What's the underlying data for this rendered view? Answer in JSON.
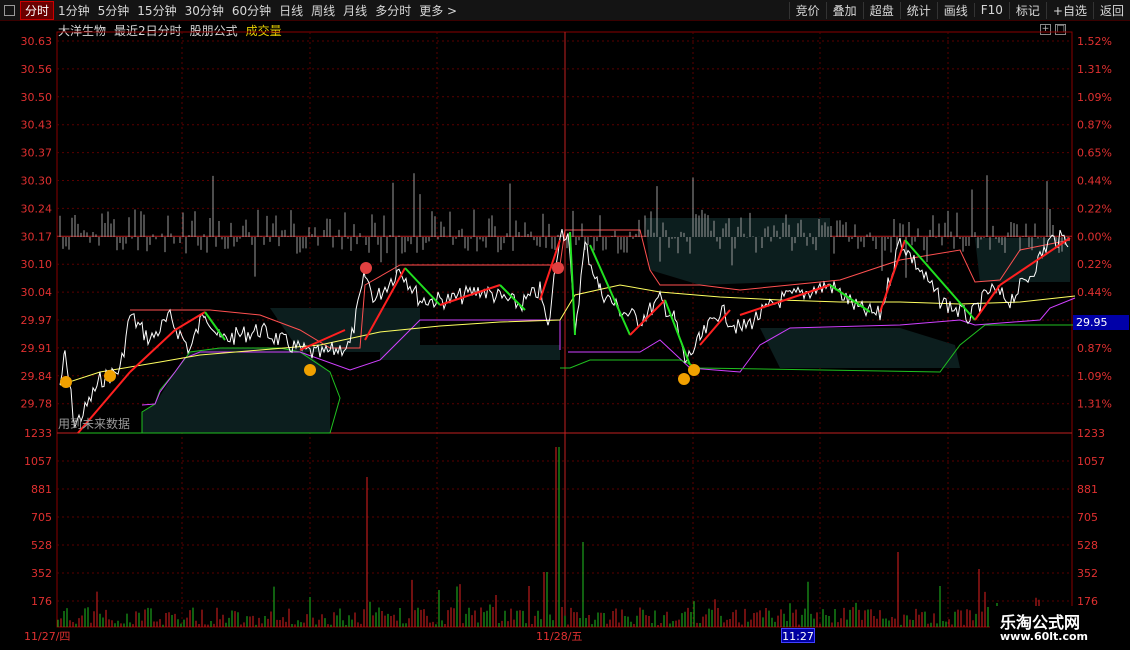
{
  "toolbar": {
    "periods": [
      "分时",
      "1分钟",
      "5分钟",
      "15分钟",
      "30分钟",
      "60分钟",
      "日线",
      "周线",
      "月线",
      "多分时",
      "更多 >"
    ],
    "tools": [
      "竞价",
      "叠加",
      "超盘",
      "统计",
      "画线",
      "F10",
      "标记",
      "+自选",
      "返回"
    ]
  },
  "info": {
    "stock_name": "大洋生物",
    "mode": "最近2日分时",
    "formula": "股朋公式",
    "volume_label": "成交量"
  },
  "price_axis": [
    "30.63",
    "30.56",
    "30.50",
    "30.43",
    "30.37",
    "30.30",
    "30.24",
    "30.17",
    "30.10",
    "30.04",
    "29.97",
    "29.91",
    "29.84",
    "29.78"
  ],
  "pct_axis": [
    "1.52%",
    "1.31%",
    "1.09%",
    "0.87%",
    "0.65%",
    "0.44%",
    "0.22%",
    "0.00%",
    "0.22%",
    "0.44%",
    "0.65%",
    "0.87%",
    "1.09%",
    "1.31%"
  ],
  "volume_axis": [
    "1233",
    "1057",
    "881",
    "705",
    "528",
    "352",
    "176"
  ],
  "current_price": "29.95",
  "future_note": "用到未来数据",
  "dates": [
    "11/27/四",
    "11/28/五"
  ],
  "time_cursor": "11:27",
  "watermark": {
    "title": "乐淘公式网",
    "url": "www.60lt.com"
  },
  "colors": {
    "up": "#ff2020",
    "down": "#20e020",
    "price_line": "#ffffff",
    "avg_line": "#ffff60",
    "magenta": "#d040ff"
  }
}
